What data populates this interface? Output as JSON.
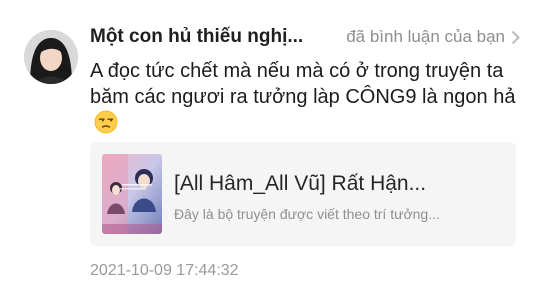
{
  "comment": {
    "username": "Một con hủ thiếu nghị...",
    "action_label": "đã bình luận của bạn",
    "text": "A đọc tức chết mà nếu mà có ở trong truyện ta băm các ngươi ra tưởng làp CÔNG9 là ngon hả",
    "emoji": "unamused-face",
    "timestamp": "2021-10-09 17:44:32"
  },
  "story_card": {
    "title": "[All Hâm_All Vũ] Rất Hận...",
    "description": "Đây là bộ truyện được viết theo trí tưởng..."
  },
  "icons": {
    "chevron": "chevron-right-icon"
  },
  "colors": {
    "muted_text": "#8e8e8e",
    "card_background": "#f5f5f5"
  }
}
